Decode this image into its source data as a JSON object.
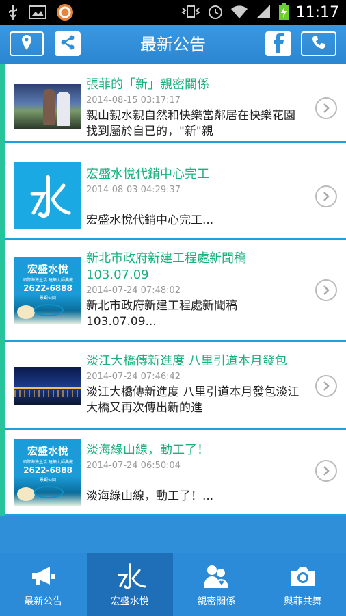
{
  "status_bar": {
    "time": "11:17"
  },
  "header": {
    "title": "最新公告"
  },
  "news": [
    {
      "title": "張菲的「新」親密關係",
      "date": "2014-08-15 03:17:17",
      "desc": "親山親水親自然和快樂當鄰居在快樂花園找到屬於自已的，\"新\"親"
    },
    {
      "title": "宏盛水悅代銷中心完工",
      "date": "2014-08-03 04:29:37",
      "desc": "宏盛水悅代銷中心完工..."
    },
    {
      "title": "新北市政府新建工程處新聞稿103.07.09",
      "date": "2014-07-24 07:48:02",
      "desc": "新北市政府新建工程處新聞稿103.07.09..."
    },
    {
      "title": "淡江大橋傳新進度 八里引道本月發包",
      "date": "2014-07-24 07:46:42",
      "desc": "淡江大橋傳新進度 八里引道本月發包淡江大橋又再次傳出新的進"
    },
    {
      "title": "淡海綠山線，動工了！",
      "date": "2014-07-24 06:50:04",
      "desc": "淡海綠山線，動工了！..."
    }
  ],
  "ad": {
    "brand": "宏盛水悅",
    "sub": "國際海灣生活 建築大師典藏",
    "phone": "2622-6888",
    "tag": "景觀公園"
  },
  "tabs": [
    {
      "label": "最新公告",
      "icon": "megaphone-icon"
    },
    {
      "label": "宏盛水悅",
      "icon": "water-logo-icon"
    },
    {
      "label": "親密關係",
      "icon": "couple-icon"
    },
    {
      "label": "與菲共舞",
      "icon": "camera-icon"
    }
  ],
  "colors": {
    "header": "#2f8fd9",
    "accent": "#27c49b",
    "title_green": "#1bb07f",
    "active_tab": "#1e6fb8"
  }
}
